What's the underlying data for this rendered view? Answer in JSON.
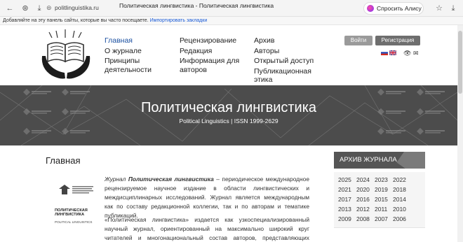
{
  "browser": {
    "url": "politlinguistika.ru",
    "tab_title": "Политическая лингвистика - Политическая лингвистика",
    "alice_label": "Спросить Алису AI",
    "bookmarks_text": "Добавляйте на эту панель сайты, которые вы часто посещаете.",
    "bookmarks_link": "Импортировать закладки"
  },
  "menu": {
    "col1": [
      "Главная",
      "О журнале",
      "Принципы",
      "деятельности"
    ],
    "col2": [
      "Рецензирование",
      "Редакция",
      "Информация для",
      "авторов"
    ],
    "col3": [
      "Архив",
      "Авторы",
      "Открытый доступ",
      "Публикационная",
      "этика"
    ]
  },
  "auth": {
    "login": "Войти",
    "register": "Регистрация"
  },
  "banner": {
    "title": "Политическая лингвистика",
    "subtitle": "Political Linguistics | ISSN 1999-2629"
  },
  "content": {
    "heading": "Главная",
    "journal_logo_title": "ПОЛИТИЧЕСКАЯ ЛИНГВИСТИКА",
    "journal_logo_sub": "POLITICAL LINGUISTICS",
    "p1_prefix": "Журнал ",
    "p1_name": "Политическая лингвистика",
    "p1_rest": " – периодическое международное рецензируемое научное издание в области лингвистических и междисциплинарных исследований. Журнал является международным как по составу редакционной коллегии, так и по авторам и тематике публикаций.",
    "p2": "«Политическая лингвистика» издается как узкоспециализированный научный журнал, ориентированный на максимально широкий круг читателей и многонациональный состав авторов, представляющих различные научные"
  },
  "archive": {
    "title": "АРХИВ ЖУРНАЛА",
    "years": [
      "2025",
      "2024",
      "2023",
      "2022",
      "2021",
      "2020",
      "2019",
      "2018",
      "2017",
      "2016",
      "2015",
      "2014",
      "2013",
      "2012",
      "2011",
      "2010",
      "2009",
      "2008",
      "2007",
      "2006"
    ]
  }
}
